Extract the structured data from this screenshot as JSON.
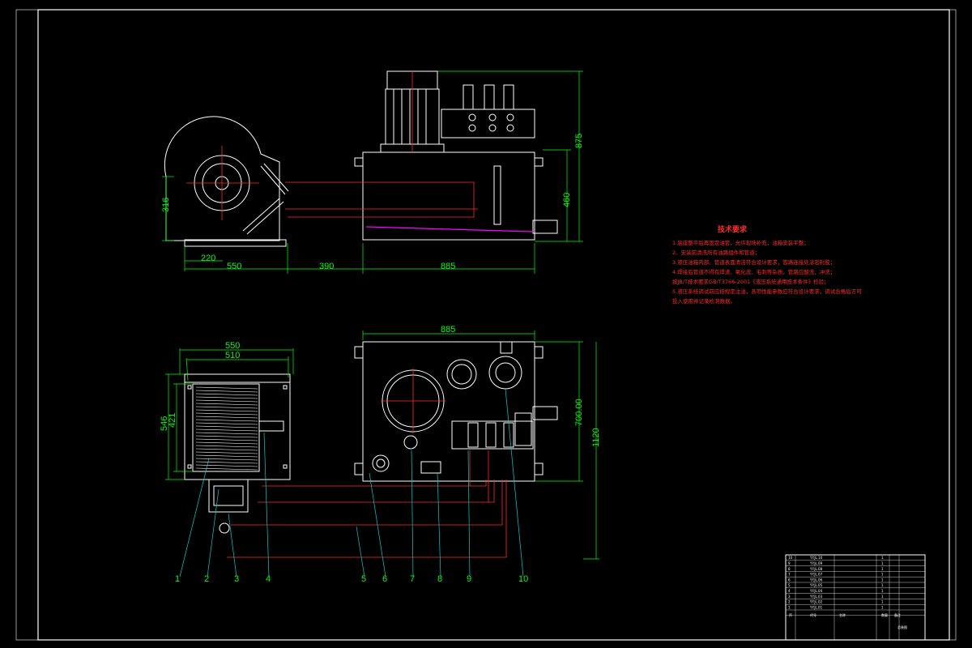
{
  "dimensions_top": {
    "h316": "316",
    "w220": "220",
    "w550": "550",
    "w390": "390",
    "w885": "885",
    "h875": "875",
    "h460": "460"
  },
  "dimensions_bottom": {
    "w885": "885",
    "w550": "550",
    "w510": "510",
    "h546": "546",
    "h421": "421",
    "h700": "700.00",
    "h1120": "1120"
  },
  "balloons": [
    "1",
    "2",
    "3",
    "4",
    "5",
    "6",
    "7",
    "8",
    "9",
    "10"
  ],
  "tech_notes": {
    "title": "技术要求",
    "lines": [
      "1.底座整平后再固定油管，允许现场补充，油箱安装平整；",
      "2、安装前清洗所有油路组件和管道；",
      "3.液压油箱内部、管道表面清洁符合设计要求，管路连接处涂密封胶；",
      "4.焊接后管道不得有焊渣、氧化皮、毛刺等杂质，管路应酸洗、冲洗；",
      "按JB/T技术要求GB/T3766-2001《液压系统通用技术条件》检验；",
      "5.液压系统调试前应按规定注油，各项性能参数应符合设计要求，调试合格后方可",
      "投入使用并记录检测数据。"
    ]
  },
  "title_block": {
    "rows": [
      [
        "10",
        "YY.JL.10",
        "",
        "1",
        ""
      ],
      [
        "9",
        "YY.JL.09",
        "",
        "1",
        ""
      ],
      [
        "8",
        "YY.JL.08",
        "",
        "1",
        ""
      ],
      [
        "7",
        "YY.JL.07",
        "",
        "1",
        ""
      ],
      [
        "6",
        "YY.JL.06",
        "",
        "1",
        ""
      ],
      [
        "5",
        "YY.JL.05",
        "",
        "1",
        ""
      ],
      [
        "4",
        "YY.JL.04",
        "",
        "1",
        ""
      ],
      [
        "3",
        "YY.JL.03",
        "",
        "1",
        ""
      ],
      [
        "2",
        "YY.JL.02",
        "",
        "1",
        ""
      ],
      [
        "1",
        "YY.JL.01",
        "",
        "1",
        ""
      ]
    ],
    "header": [
      "序",
      "代号",
      "名称",
      "数量",
      "备注"
    ],
    "drawing_name": "总装图"
  }
}
